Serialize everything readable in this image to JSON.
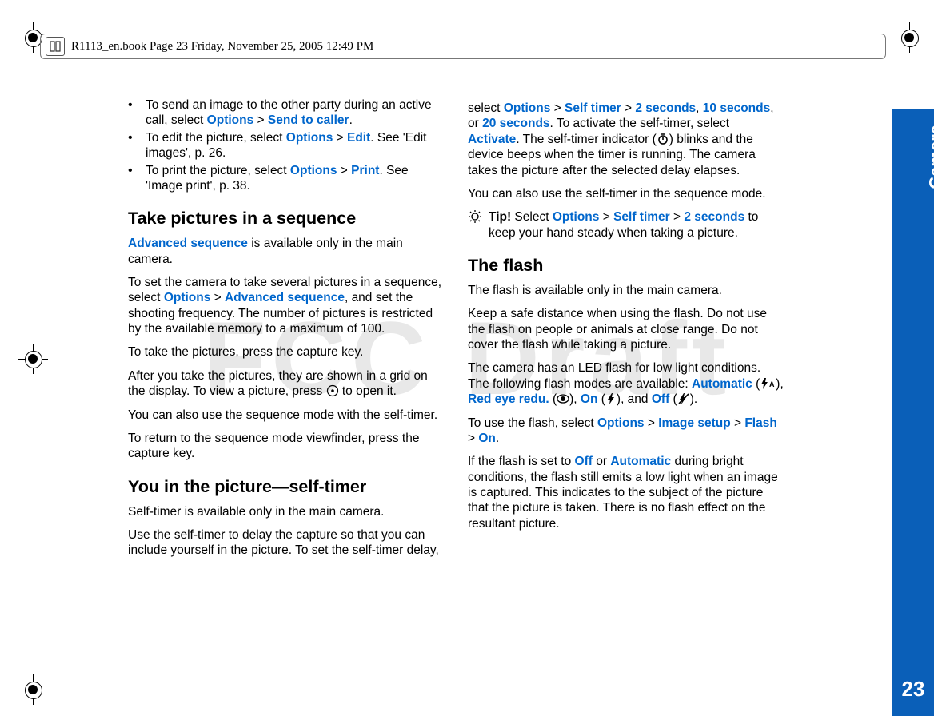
{
  "header": "R1113_en.book  Page 23  Friday, November 25, 2005  12:49 PM",
  "watermark": "FCC Draft",
  "chapter": "Camera",
  "page_number": "23",
  "col1": {
    "b1a": "To send an image to the other party during an active call, select ",
    "b1b": "Options",
    "b1c": " > ",
    "b1d": "Send to caller",
    "b1e": ".",
    "b2a": "To edit the picture, select ",
    "b2b": "Options",
    "b2c": " > ",
    "b2d": "Edit",
    "b2e": ". See 'Edit images', p. 26.",
    "b3a": "To print the picture, select ",
    "b3b": "Options",
    "b3c": " > ",
    "b3d": "Print",
    "b3e": ". See 'Image print', p. 38.",
    "h1": "Take pictures in a sequence",
    "p1a": "Advanced sequence",
    "p1b": " is available only in the main camera.",
    "p2a": "To set the camera to take several pictures in a sequence, select ",
    "p2b": "Options",
    "p2c": " > ",
    "p2d": "Advanced sequence",
    "p2e": ", and set the shooting frequency. The number of pictures is restricted by the available memory to a maximum of 100.",
    "p3": "To take the pictures, press the capture key.",
    "p4a": "After you take the pictures, they are shown in a grid on the display. To view a picture, press ",
    "p4b": " to open it.",
    "p5": "You can also use the sequence mode with the self-timer.",
    "p6": "To return to the sequence mode viewfinder, press the capture key.",
    "h2": "You in the picture—self-timer",
    "p7": "Self-timer is available only in the main camera.",
    "p8": "Use the self-timer to delay the capture so that you can include yourself in the picture. To set the self-timer delay,"
  },
  "col2": {
    "p1a": "select ",
    "p1b": "Options",
    "p1c": " > ",
    "p1d": "Self timer",
    "p1e": " > ",
    "p1f": "2 seconds",
    "p1g": ", ",
    "p1h": "10 seconds",
    "p1i": ", or ",
    "p1j": "20 seconds",
    "p1k": ". To activate the self-timer, select ",
    "p1l": "Activate",
    "p1m": ". The self-timer indicator (",
    "p1n": ") blinks and the device beeps when the timer is running. The camera takes the picture after the selected delay elapses.",
    "p2": "You can also use the self-timer in the sequence mode.",
    "tip_label": "Tip!",
    "tip_a": " Select ",
    "tip_b": "Options",
    "tip_c": " > ",
    "tip_d": "Self timer",
    "tip_e": " > ",
    "tip_f": "2 seconds",
    "tip_g": " to keep your hand steady when taking a picture.",
    "h1": "The flash",
    "p3": "The flash is available only in the main camera.",
    "p4": "Keep a safe distance when using the flash. Do not use the flash on people or animals at close range.  Do not cover the flash while taking a picture.",
    "p5a": "The camera has an LED flash for low light conditions. The following flash modes are available: ",
    "p5b": "Automatic",
    "p5c": " (",
    "p5d": "), ",
    "p5e": "Red eye redu.",
    "p5f": " (",
    "p5g": "), ",
    "p5h": "On",
    "p5i": " (",
    "p5j": "), and ",
    "p5k": "Off",
    "p5l": " (",
    "p5m": ").",
    "p6a": "To use the flash, select ",
    "p6b": "Options",
    "p6c": " > ",
    "p6d": "Image setup",
    "p6e": " > ",
    "p6f": "Flash",
    "p6g": " > ",
    "p6h": "On",
    "p6i": ".",
    "p7a": "If the flash is set to ",
    "p7b": "Off",
    "p7c": " or ",
    "p7d": "Automatic",
    "p7e": " during bright conditions, the flash still emits a low light when an image is captured. This  indicates to the subject of the picture that the picture is taken. There is no flash effect on the resultant picture."
  }
}
